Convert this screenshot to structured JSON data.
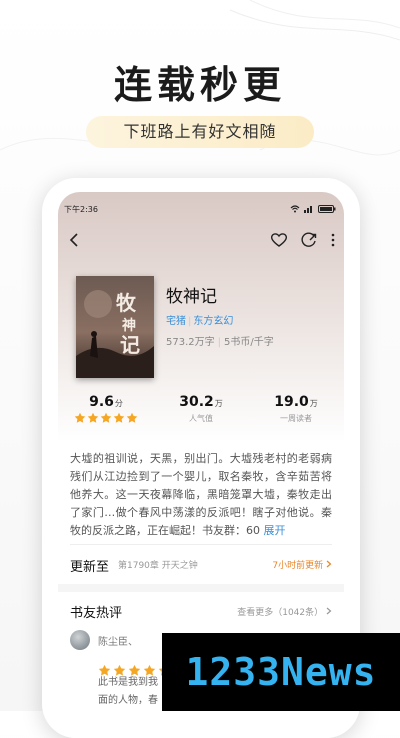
{
  "promo": {
    "headline": "连载秒更",
    "subheadline": "下班路上有好文相随"
  },
  "status_bar": {
    "time": "下午2:36"
  },
  "toolbar": {
    "icons": [
      "back-arrow-icon",
      "heart-icon",
      "share-icon",
      "more-vertical-icon"
    ]
  },
  "book": {
    "title": "牧神记",
    "author": "宅猪",
    "category": "东方玄幻",
    "word_count": "573.2万字",
    "price": "5书币/千字",
    "cover_title": "牧神记"
  },
  "stats": [
    {
      "value": "9.6",
      "unit": "分",
      "label": "",
      "stars": 5
    },
    {
      "value": "30.2",
      "unit": "万",
      "label": "人气值"
    },
    {
      "value": "19.0",
      "unit": "万",
      "label": "一周读者"
    }
  ],
  "description": {
    "text": "大墟的祖训说，天黑，别出门。大墟残老村的老弱病残们从江边捡到了一个婴儿，取名秦牧，含辛茹苦将他养大。这一天夜幕降临，黑暗笼罩大墟，秦牧走出了家门…做个春风中荡漾的反派吧！瞎子对他说。秦牧的反派之路，正在崛起！书友群：60",
    "expand_label": "展开"
  },
  "latest_update": {
    "label": "更新至",
    "chapter": "第1790章 开天之钟",
    "time": "7小时前更新"
  },
  "reviews": {
    "title": "书友热评",
    "more_label": "查看更多（1042条）",
    "items": [
      {
        "name": "陈尘臣、",
        "stars": 5,
        "text_line1": "此书是我到我",
        "text_line2": "面的人物，春"
      }
    ]
  },
  "watermark": {
    "text": "1233News"
  },
  "colors": {
    "accent_blue": "#3a8fd8",
    "star_orange": "#f5a623",
    "update_orange": "#e8862a",
    "pill_bg": "#fbecc6"
  }
}
